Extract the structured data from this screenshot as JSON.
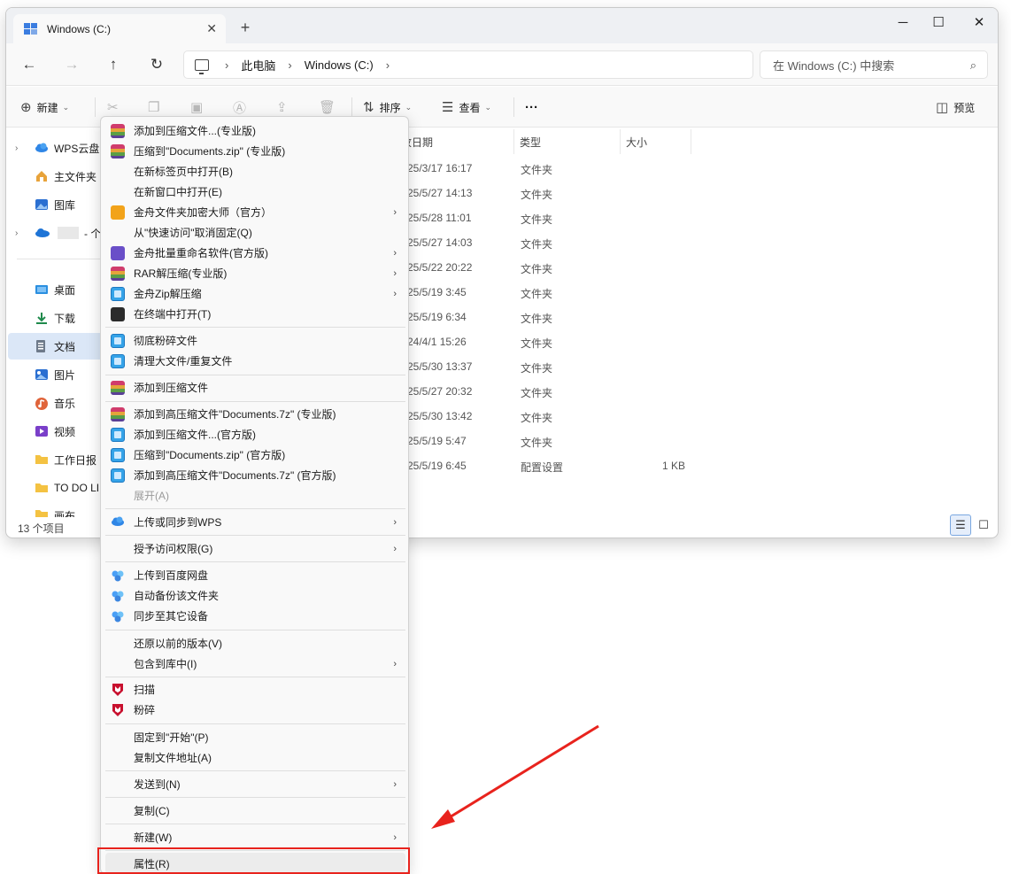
{
  "window": {
    "tab_title": "Windows (C:)",
    "new_tab": "+",
    "minimize": "─",
    "maximize": "☐",
    "close": "✕"
  },
  "address": {
    "back": "←",
    "forward": "→",
    "up": "↑",
    "refresh": "↻",
    "crumbs": [
      "此电脑",
      "Windows (C:)"
    ],
    "search_placeholder": "在 Windows (C:) 中搜索"
  },
  "toolbar": {
    "new_label": "新建",
    "sort_label": "排序",
    "view_label": "查看",
    "more_label": "···",
    "preview_label": "预览"
  },
  "nav": {
    "items": [
      {
        "label": "WPS云盘",
        "icon": "wps-cloud-icon"
      },
      {
        "label": "主文件夹",
        "icon": "home-icon"
      },
      {
        "label": "图库",
        "icon": "gallery-icon"
      },
      {
        "label": "- 个人",
        "icon": "onedrive-icon"
      },
      {
        "label": "桌面",
        "icon": "desktop-icon"
      },
      {
        "label": "下载",
        "icon": "download-icon"
      },
      {
        "label": "文档",
        "icon": "document-icon"
      },
      {
        "label": "图片",
        "icon": "pictures-icon"
      },
      {
        "label": "音乐",
        "icon": "music-icon"
      },
      {
        "label": "视频",
        "icon": "video-icon"
      },
      {
        "label": "工作日报",
        "icon": "folder-icon"
      },
      {
        "label": "TO DO LI",
        "icon": "folder-icon"
      },
      {
        "label": "画布",
        "icon": "folder-icon"
      }
    ]
  },
  "columns": {
    "date": "改日期",
    "type": "类型",
    "size": "大小"
  },
  "files": [
    {
      "date": "25/3/17 16:17",
      "type": "文件夹",
      "size": ""
    },
    {
      "date": "25/5/27 14:13",
      "type": "文件夹",
      "size": ""
    },
    {
      "date": "25/5/28 11:01",
      "type": "文件夹",
      "size": ""
    },
    {
      "date": "25/5/27 14:03",
      "type": "文件夹",
      "size": ""
    },
    {
      "date": "25/5/22 20:22",
      "type": "文件夹",
      "size": ""
    },
    {
      "date": "25/5/19 3:45",
      "type": "文件夹",
      "size": ""
    },
    {
      "date": "25/5/19 6:34",
      "type": "文件夹",
      "size": ""
    },
    {
      "date": "24/4/1 15:26",
      "type": "文件夹",
      "size": ""
    },
    {
      "date": "25/5/30 13:37",
      "type": "文件夹",
      "size": ""
    },
    {
      "date": "25/5/27 20:32",
      "type": "文件夹",
      "size": ""
    },
    {
      "date": "25/5/30 13:42",
      "type": "文件夹",
      "size": ""
    },
    {
      "date": "25/5/19 5:47",
      "type": "文件夹",
      "size": ""
    },
    {
      "date": "25/5/19 6:45",
      "type": "配置设置",
      "size": "1 KB"
    }
  ],
  "status": {
    "count": "13 个项目"
  },
  "menu": {
    "items": [
      {
        "label": "添加到压缩文件...(专业版)",
        "icon": "rar"
      },
      {
        "label": "压缩到\"Documents.zip\" (专业版)",
        "icon": "rar"
      },
      {
        "label": "在新标签页中打开(B)",
        "icon": ""
      },
      {
        "label": "在新窗口中打开(E)",
        "icon": ""
      },
      {
        "label": "金舟文件夹加密大师（官方）",
        "icon": "lock",
        "sub": true
      },
      {
        "label": "从\"快速访问\"取消固定(Q)",
        "icon": ""
      },
      {
        "label": "金舟批量重命名软件(官方版)",
        "icon": "rename",
        "sub": true
      },
      {
        "label": "RAR解压缩(专业版)",
        "icon": "rar",
        "sub": true
      },
      {
        "label": "金舟Zip解压缩",
        "icon": "zip",
        "sub": true
      },
      {
        "label": "在终端中打开(T)",
        "icon": "term"
      },
      {
        "label": "彻底粉碎文件",
        "icon": "zip"
      },
      {
        "label": "清理大文件/重复文件",
        "icon": "zip"
      },
      {
        "label": "添加到压缩文件",
        "icon": "rar"
      },
      {
        "label": "添加到高压缩文件\"Documents.7z\" (专业版)",
        "icon": "rar"
      },
      {
        "label": "添加到压缩文件...(官方版)",
        "icon": "zip"
      },
      {
        "label": "压缩到\"Documents.zip\" (官方版)",
        "icon": "zip"
      },
      {
        "label": "添加到高压缩文件\"Documents.7z\" (官方版)",
        "icon": "zip"
      },
      {
        "label": "展开(A)",
        "icon": "",
        "disabled": true
      },
      {
        "label": "上传或同步到WPS",
        "icon": "cloud",
        "sub": true
      },
      {
        "label": "授予访问权限(G)",
        "icon": "",
        "sub": true
      },
      {
        "label": "上传到百度网盘",
        "icon": "baidu"
      },
      {
        "label": "自动备份该文件夹",
        "icon": "baidu"
      },
      {
        "label": "同步至其它设备",
        "icon": "baidu"
      },
      {
        "label": "还原以前的版本(V)",
        "icon": ""
      },
      {
        "label": "包含到库中(I)",
        "icon": "",
        "sub": true
      },
      {
        "label": "扫描",
        "icon": "mcafee"
      },
      {
        "label": "粉碎",
        "icon": "mcafee"
      },
      {
        "label": "固定到\"开始\"(P)",
        "icon": ""
      },
      {
        "label": "复制文件地址(A)",
        "icon": ""
      },
      {
        "label": "发送到(N)",
        "icon": "",
        "sub": true
      },
      {
        "label": "复制(C)",
        "icon": ""
      },
      {
        "label": "新建(W)",
        "icon": "",
        "sub": true
      },
      {
        "label": "属性(R)",
        "icon": ""
      }
    ]
  },
  "colors": {
    "highlight": "#e8231d",
    "arrow": "#e8231d",
    "selection": "#dbe7f7"
  }
}
